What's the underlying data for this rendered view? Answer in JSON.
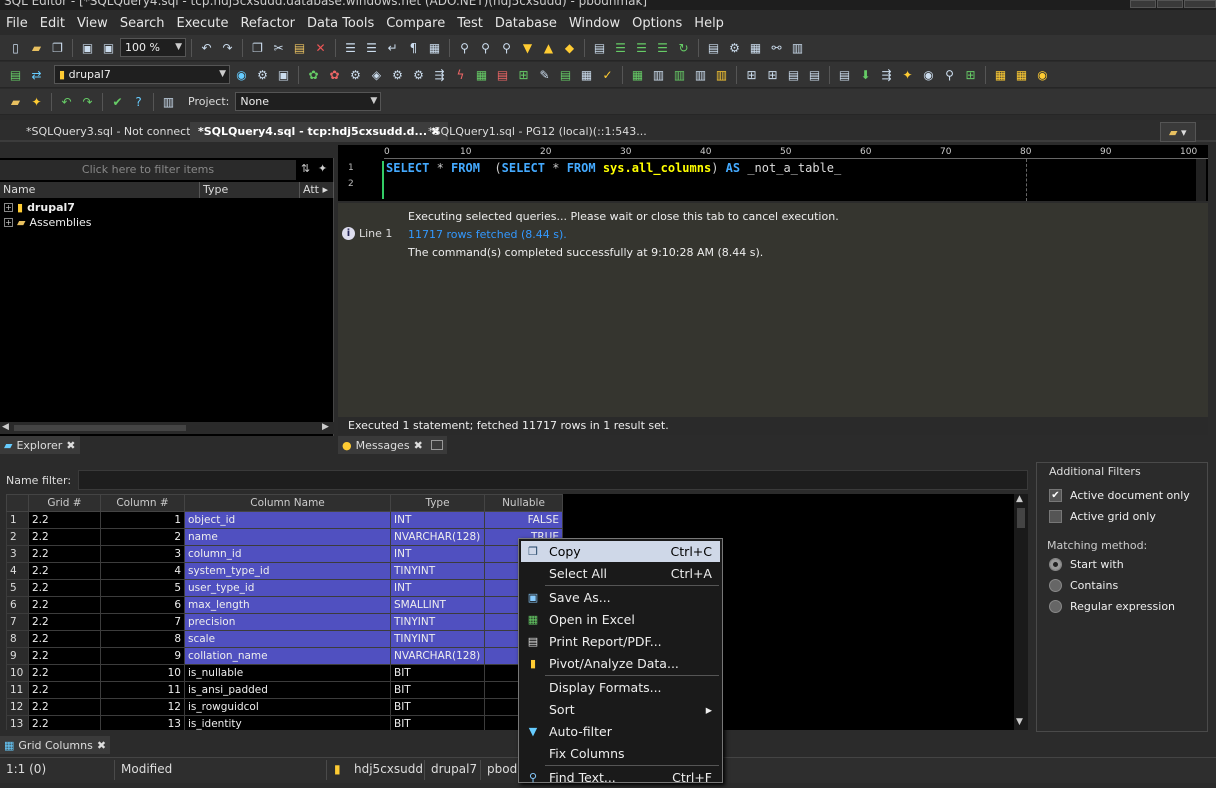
{
  "title_bar": {
    "text": "SQL Editor - [*SQLQuery4.sql - tcp:hdj5cxsudd.database.windows.net (ADO.NET)(hdj5cxsudd) - pbodnmak]"
  },
  "menu": [
    "File",
    "Edit",
    "View",
    "Search",
    "Execute",
    "Refactor",
    "Data Tools",
    "Compare",
    "Test",
    "Database",
    "Window",
    "Options",
    "Help"
  ],
  "toolbar": {
    "zoom_value": "100 %",
    "database_value": "drupal7",
    "project_label": "Project:",
    "project_value": "None"
  },
  "tabs": [
    {
      "label": "*SQLQuery3.sql - Not connected"
    },
    {
      "label": "*SQLQuery4.sql - tcp:hdj5cxsudd.d...",
      "active": true
    },
    {
      "label": "*SQLQuery1.sql - PG12 (local)(::1:543..."
    }
  ],
  "explorer": {
    "filter_placeholder": "Click here to filter items",
    "columns": [
      "Name",
      "Type",
      "Att"
    ],
    "items": [
      {
        "label": "drupal7"
      },
      {
        "label": "Assemblies"
      }
    ],
    "tab_label": "Explorer"
  },
  "editor": {
    "ruler": [
      "0",
      "10",
      "20",
      "30",
      "40",
      "50",
      "60",
      "70",
      "80",
      "90",
      "100"
    ],
    "line_numbers": [
      "1",
      "2"
    ],
    "code_line1": [
      "SELECT",
      " * ",
      "FROM",
      "  (",
      "SELECT",
      " * ",
      "FROM",
      " ",
      "sys.all_columns",
      ") ",
      "AS",
      " _not_a_table_"
    ]
  },
  "messages": {
    "line_label": "Line 1",
    "line1": "Executing selected queries... Please wait or close this tab to cancel execution.",
    "line2": "11717  rows fetched (8.44 s).",
    "line3": "The command(s) completed successfully at 9:10:28 AM (8.44 s).",
    "status": "Executed 1 statement; fetched 11717 rows in 1  result set.",
    "tab_label": "Messages"
  },
  "grid_columns": {
    "name_filter_label": "Name filter:",
    "headers": [
      "Grid #",
      "Column #",
      "Column Name",
      "Type",
      "Nullable"
    ],
    "rows": [
      [
        "1",
        "2.2",
        "1",
        "object_id",
        "INT",
        "FALSE"
      ],
      [
        "2",
        "2.2",
        "2",
        "name",
        "NVARCHAR(128)",
        "TRUE"
      ],
      [
        "3",
        "2.2",
        "3",
        "column_id",
        "INT",
        ""
      ],
      [
        "4",
        "2.2",
        "4",
        "system_type_id",
        "TINYINT",
        ""
      ],
      [
        "5",
        "2.2",
        "5",
        "user_type_id",
        "INT",
        ""
      ],
      [
        "6",
        "2.2",
        "6",
        "max_length",
        "SMALLINT",
        ""
      ],
      [
        "7",
        "2.2",
        "7",
        "precision",
        "TINYINT",
        ""
      ],
      [
        "8",
        "2.2",
        "8",
        "scale",
        "TINYINT",
        ""
      ],
      [
        "9",
        "2.2",
        "9",
        "collation_name",
        "NVARCHAR(128)",
        ""
      ],
      [
        "10",
        "2.2",
        "10",
        "is_nullable",
        "BIT",
        ""
      ],
      [
        "11",
        "2.2",
        "11",
        "is_ansi_padded",
        "BIT",
        ""
      ],
      [
        "12",
        "2.2",
        "12",
        "is_rowguidcol",
        "BIT",
        ""
      ],
      [
        "13",
        "2.2",
        "13",
        "is_identity",
        "BIT",
        ""
      ]
    ],
    "tab_label": "Grid Columns"
  },
  "filters": {
    "title": "Additional Filters",
    "active_document": "Active document only",
    "active_grid": "Active grid only",
    "matching_label": "Matching method:",
    "start_with": "Start with",
    "contains": "Contains",
    "regex": "Regular expression"
  },
  "context_menu": [
    {
      "label": "Copy",
      "shortcut": "Ctrl+C",
      "icon": "copy-icon"
    },
    {
      "label": "Select All",
      "shortcut": "Ctrl+A",
      "icon": ""
    },
    {
      "label": "Save As...",
      "shortcut": "",
      "icon": "save-icon"
    },
    {
      "label": "Open in Excel",
      "shortcut": "",
      "icon": "excel-icon"
    },
    {
      "label": "Print Report/PDF...",
      "shortcut": "",
      "icon": "print-icon"
    },
    {
      "label": "Pivot/Analyze Data...",
      "shortcut": "",
      "icon": "chart-icon"
    },
    {
      "label": "Display Formats...",
      "shortcut": "",
      "icon": ""
    },
    {
      "label": "Sort",
      "shortcut": "",
      "icon": ""
    },
    {
      "label": "Auto-filter",
      "shortcut": "",
      "icon": "filter-icon"
    },
    {
      "label": "Fix Columns",
      "shortcut": "",
      "icon": ""
    },
    {
      "label": "Find Text...",
      "shortcut": "Ctrl+F",
      "icon": "binoculars-icon"
    }
  ],
  "status_bar": {
    "position": "1:1 (0)",
    "state": "Modified",
    "server": "hdj5cxsudd",
    "database": "drupal7",
    "user": "pbodn"
  }
}
